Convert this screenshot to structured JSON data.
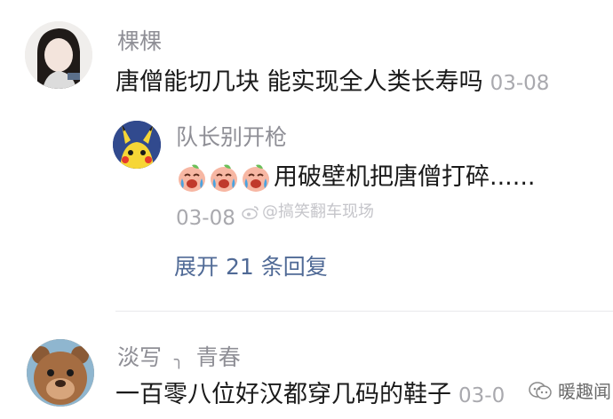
{
  "comments": [
    {
      "username": "棵棵",
      "text": "唐僧能切几块 能实现全人类长寿吗",
      "time": "03-08"
    },
    {
      "username": "淡写",
      "username_mark": "╮",
      "username_suffix": "青春",
      "text": "一百零八位好汉都穿几码的鞋子",
      "time": "03-0"
    }
  ],
  "reply": {
    "username": "队长别开枪",
    "emoji_name": "crying-laughing-peach-emoji",
    "text": "用破壁机把唐僧打碎......",
    "time": "03-08",
    "expand_label": "展开 21 条回复"
  },
  "watermarks": {
    "weibo": "@搞笑翻车现场",
    "brand": "暖趣闻"
  },
  "colors": {
    "username": "#8f8f96",
    "text": "#1a1a1a",
    "time": "#a9a9ae",
    "link": "#506a96",
    "divider": "#e8e8ec"
  }
}
